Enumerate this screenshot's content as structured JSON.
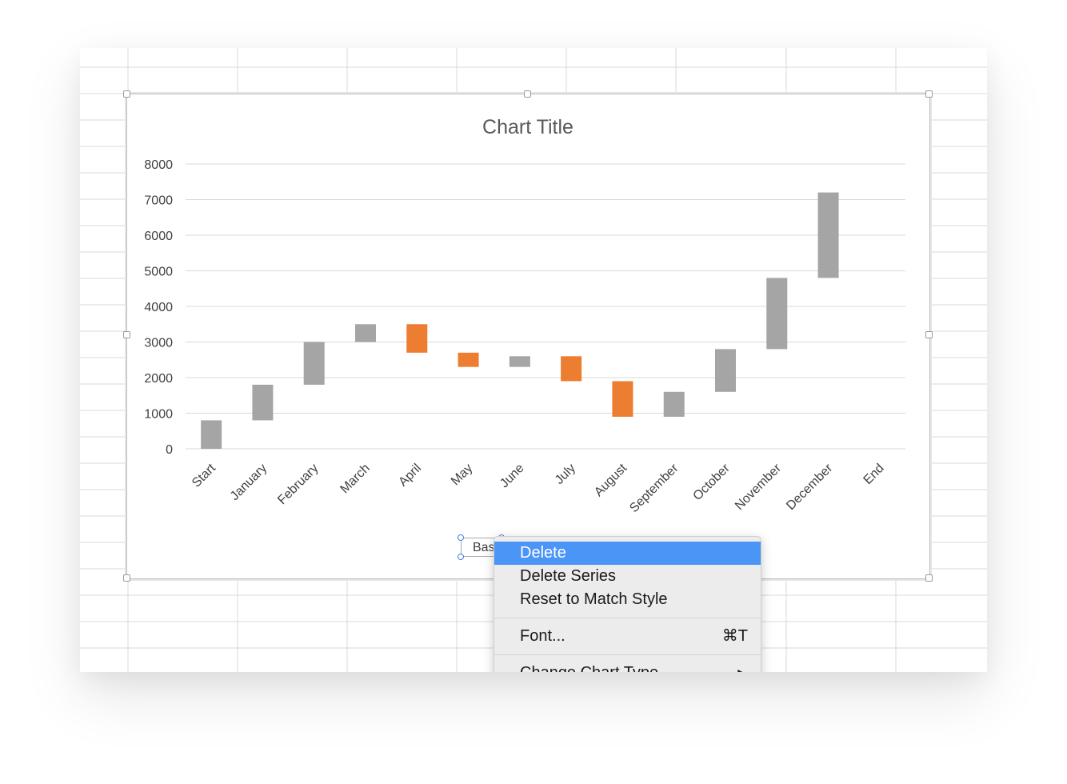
{
  "chart_data": {
    "type": "bar",
    "title": "Chart Title",
    "categories": [
      "Start",
      "January",
      "February",
      "March",
      "April",
      "May",
      "June",
      "July",
      "August",
      "September",
      "October",
      "November",
      "December",
      "End"
    ],
    "series": [
      {
        "name": "Base",
        "values": [
          0,
          800,
          1800,
          3000,
          2700,
          2300,
          2300,
          1900,
          900,
          900,
          1600,
          2800,
          4800,
          0
        ]
      },
      {
        "name": "",
        "color": "#a5a5a5",
        "values": [
          800,
          1000,
          1200,
          500,
          0,
          0,
          300,
          0,
          0,
          700,
          1200,
          2000,
          2400,
          0
        ]
      },
      {
        "name": "",
        "color": "#ed7d31",
        "values": [
          0,
          0,
          0,
          0,
          800,
          400,
          0,
          700,
          1000,
          0,
          0,
          0,
          0,
          0
        ]
      }
    ],
    "yticks": [
      "0",
      "1000",
      "2000",
      "3000",
      "4000",
      "5000",
      "6000",
      "7000",
      "8000"
    ],
    "ylim": [
      0,
      8000
    ],
    "grid": true,
    "legend": "bottom"
  },
  "legend": {
    "visible_text": "Bas"
  },
  "context_menu": {
    "items": [
      {
        "label": "Delete",
        "highlighted": true
      },
      {
        "label": "Delete Series"
      },
      {
        "label": "Reset to Match Style"
      },
      {
        "label": "Font...",
        "shortcut": "⌘T"
      },
      {
        "label": "Change Chart Type",
        "submenu_arrow": "▶"
      }
    ]
  },
  "colors": {
    "increase": "#a5a5a5",
    "decrease": "#ed7d31",
    "menu_highlight": "#4b95f6"
  }
}
